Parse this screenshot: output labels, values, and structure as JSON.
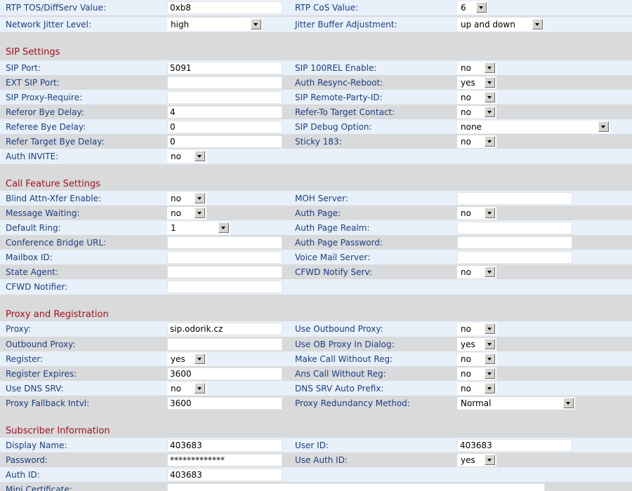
{
  "top": {
    "r1": {
      "left_label": "RTP TOS/DiffServ Value:",
      "left_value": "0xb8",
      "right_label": "RTP CoS Value:",
      "right_value": "6"
    },
    "r2": {
      "left_label": "Network Jitter Level:",
      "left_value": "high",
      "right_label": "Jitter Buffer Adjustment:",
      "right_value": "up and down"
    }
  },
  "sip": {
    "title": "SIP Settings",
    "r1": {
      "left_label": "SIP Port:",
      "left_value": "5091",
      "right_label": "SIP 100REL Enable:",
      "right_value": "no"
    },
    "r2": {
      "left_label": "EXT SIP Port:",
      "left_value": "",
      "right_label": "Auth Resync-Reboot:",
      "right_value": "yes"
    },
    "r3": {
      "left_label": "SIP Proxy-Require:",
      "left_value": "",
      "right_label": "SIP Remote-Party-ID:",
      "right_value": "no"
    },
    "r4": {
      "left_label": "Referor Bye Delay:",
      "left_value": "4",
      "right_label": "Refer-To Target Contact:",
      "right_value": "no"
    },
    "r5": {
      "left_label": "Referee Bye Delay:",
      "left_value": "0",
      "right_label": "SIP Debug Option:",
      "right_value": "none"
    },
    "r6": {
      "left_label": "Refer Target Bye Delay:",
      "left_value": "0",
      "right_label": "Sticky 183:",
      "right_value": "no"
    },
    "r7": {
      "left_label": "Auth INVITE:",
      "left_value": "no"
    }
  },
  "call": {
    "title": "Call Feature Settings",
    "r1": {
      "left_label": "Blind Attn-Xfer Enable:",
      "left_value": "no",
      "right_label": "MOH Server:",
      "right_value": ""
    },
    "r2": {
      "left_label": "Message Waiting:",
      "left_value": "no",
      "right_label": "Auth Page:",
      "right_value": "no"
    },
    "r3": {
      "left_label": "Default Ring:",
      "left_value": "1",
      "right_label": "Auth Page Realm:",
      "right_value": ""
    },
    "r4": {
      "left_label": "Conference Bridge URL:",
      "left_value": "",
      "right_label": "Auth Page Password:",
      "right_value": ""
    },
    "r5": {
      "left_label": "Mailbox ID:",
      "left_value": "",
      "right_label": "Voice Mail Server:",
      "right_value": ""
    },
    "r6": {
      "left_label": "State Agent:",
      "left_value": "",
      "right_label": "CFWD Notify Serv:",
      "right_value": "no"
    },
    "r7": {
      "left_label": "CFWD Notifier:",
      "left_value": ""
    }
  },
  "proxy": {
    "title": "Proxy and Registration",
    "r1": {
      "left_label": "Proxy:",
      "left_value": "sip.odorik.cz",
      "right_label": "Use Outbound Proxy:",
      "right_value": "no"
    },
    "r2": {
      "left_label": "Outbound Proxy:",
      "left_value": "",
      "right_label": "Use OB Proxy In Dialog:",
      "right_value": "yes"
    },
    "r3": {
      "left_label": "Register:",
      "left_value": "yes",
      "right_label": "Make Call Without Reg:",
      "right_value": "no"
    },
    "r4": {
      "left_label": "Register Expires:",
      "left_value": "3600",
      "right_label": "Ans Call Without Reg:",
      "right_value": "no"
    },
    "r5": {
      "left_label": "Use DNS SRV:",
      "left_value": "no",
      "right_label": "DNS SRV Auto Prefix:",
      "right_value": "no"
    },
    "r6": {
      "left_label": "Proxy Fallback Intvl:",
      "left_value": "3600",
      "right_label": "Proxy Redundancy Method:",
      "right_value": "Normal"
    }
  },
  "subscriber": {
    "title": "Subscriber Information",
    "r1": {
      "left_label": "Display Name:",
      "left_value": "403683",
      "right_label": "User ID:",
      "right_value": "403683"
    },
    "r2": {
      "left_label": "Password:",
      "left_value": "*************",
      "right_label": "Use Auth ID:",
      "right_value": "yes"
    },
    "r3": {
      "left_label": "Auth ID:",
      "left_value": "403683"
    },
    "r4": {
      "left_label": "Mini Certificate:",
      "left_value": ""
    }
  }
}
